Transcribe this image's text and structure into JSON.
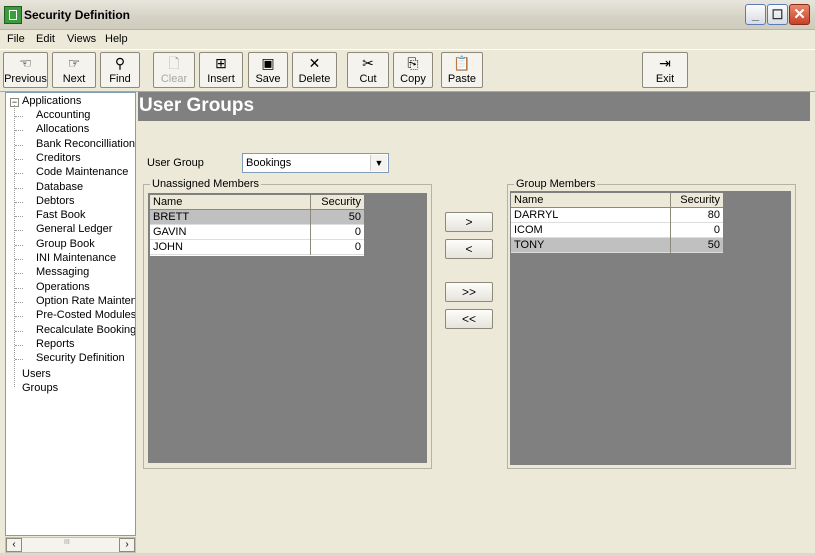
{
  "window": {
    "title": "Security Definition"
  },
  "menu": [
    "File",
    "Edit",
    "Views",
    "Help"
  ],
  "toolbar": {
    "previous": "Previous",
    "next": "Next",
    "find": "Find",
    "clear": "Clear",
    "insert": "Insert",
    "save": "Save",
    "delete": "Delete",
    "cut": "Cut",
    "copy": "Copy",
    "paste": "Paste",
    "exit": "Exit"
  },
  "tree": {
    "root": "Applications",
    "applications": [
      "Accounting",
      "Allocations",
      "Bank Reconcilliation",
      "Creditors",
      "Code Maintenance",
      "Database",
      "Debtors",
      "Fast Book",
      "General Ledger",
      "Group Book",
      "INI Maintenance",
      "Messaging",
      "Operations",
      "Option Rate Mainten",
      "Pre-Costed Modules",
      "Recalculate Booking",
      "Reports",
      "Security Definition"
    ],
    "users": "Users",
    "groups": "Groups",
    "scroll_mid": "III"
  },
  "page": {
    "title": "User Groups",
    "user_group_label": "User Group",
    "user_group_value": "Bookings"
  },
  "unassigned": {
    "title": "Unassigned Members",
    "col_name": "Name",
    "col_security": "Security",
    "rows": [
      {
        "name": "BRETT",
        "security": "50"
      },
      {
        "name": "GAVIN",
        "security": "0"
      },
      {
        "name": "JOHN",
        "security": "0"
      }
    ]
  },
  "members": {
    "title": "Group Members",
    "col_name": "Name",
    "col_security": "Security",
    "rows": [
      {
        "name": "DARRYL",
        "security": "80"
      },
      {
        "name": "ICOM",
        "security": "0"
      },
      {
        "name": "TONY",
        "security": "50"
      }
    ]
  },
  "move_buttons": {
    "add": ">",
    "remove": "<",
    "add_all": ">>",
    "remove_all": "<<"
  }
}
